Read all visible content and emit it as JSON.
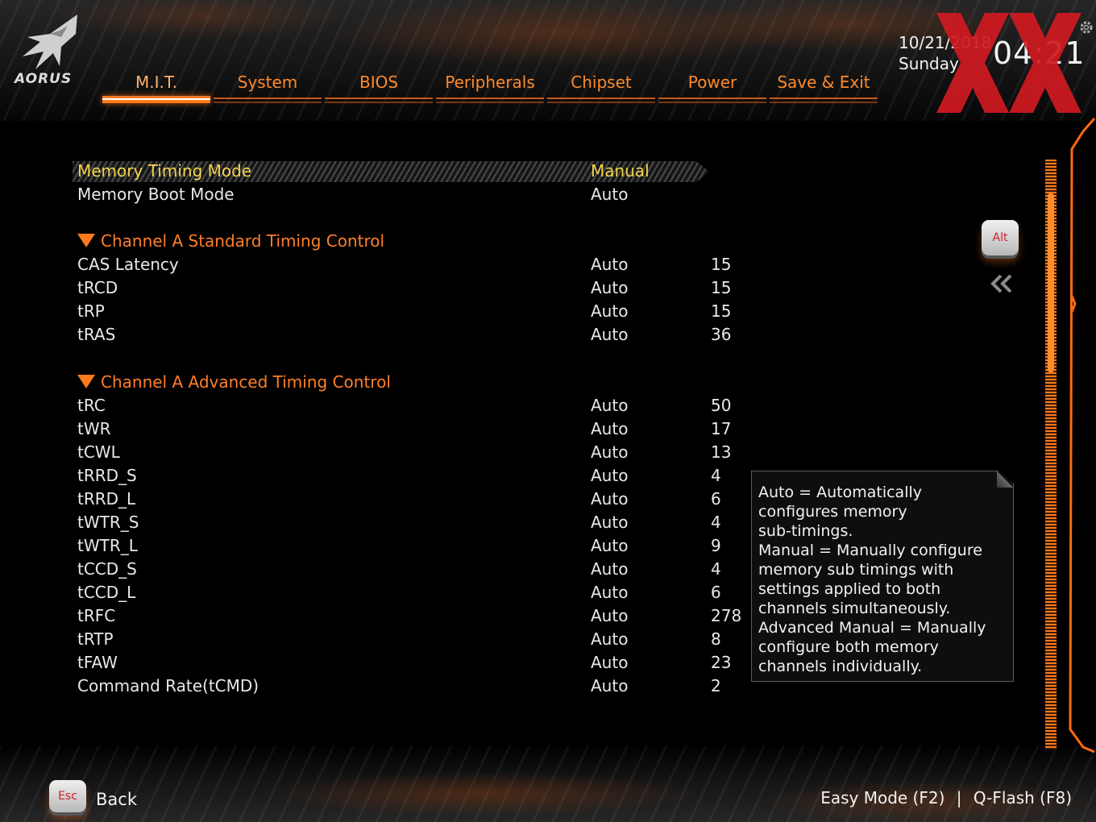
{
  "brand": {
    "logo_text": "AORUS"
  },
  "nav": {
    "tabs": [
      {
        "label": "M.I.T.",
        "active": true
      },
      {
        "label": "System",
        "active": false
      },
      {
        "label": "BIOS",
        "active": false
      },
      {
        "label": "Peripherals",
        "active": false
      },
      {
        "label": "Chipset",
        "active": false
      },
      {
        "label": "Power",
        "active": false
      },
      {
        "label": "Save & Exit",
        "active": false
      }
    ]
  },
  "datetime": {
    "date": "10/21/2018",
    "day": "Sunday",
    "time": "04:21"
  },
  "top_rows": [
    {
      "label": "Memory Timing Mode",
      "mode": "Manual",
      "value": ""
    },
    {
      "label": "Memory Boot Mode",
      "mode": "Auto",
      "value": ""
    }
  ],
  "sections": {
    "standard": {
      "title": "Channel A Standard Timing Control",
      "rows": [
        {
          "label": "CAS Latency",
          "mode": "Auto",
          "value": "15"
        },
        {
          "label": "tRCD",
          "mode": "Auto",
          "value": "15"
        },
        {
          "label": "tRP",
          "mode": "Auto",
          "value": "15"
        },
        {
          "label": "tRAS",
          "mode": "Auto",
          "value": "36"
        }
      ]
    },
    "advanced": {
      "title": "Channel A Advanced Timing Control",
      "rows": [
        {
          "label": "tRC",
          "mode": "Auto",
          "value": "50"
        },
        {
          "label": "tWR",
          "mode": "Auto",
          "value": "17"
        },
        {
          "label": "tCWL",
          "mode": "Auto",
          "value": "13"
        },
        {
          "label": "tRRD_S",
          "mode": "Auto",
          "value": "4"
        },
        {
          "label": "tRRD_L",
          "mode": "Auto",
          "value": "6"
        },
        {
          "label": "tWTR_S",
          "mode": "Auto",
          "value": "4"
        },
        {
          "label": "tWTR_L",
          "mode": "Auto",
          "value": "9"
        },
        {
          "label": "tCCD_S",
          "mode": "Auto",
          "value": "4"
        },
        {
          "label": "tCCD_L",
          "mode": "Auto",
          "value": "6"
        },
        {
          "label": "tRFC",
          "mode": "Auto",
          "value": "278"
        },
        {
          "label": "tRTP",
          "mode": "Auto",
          "value": "8"
        },
        {
          "label": "tFAW",
          "mode": "Auto",
          "value": "23"
        },
        {
          "label": "Command Rate(tCMD)",
          "mode": "Auto",
          "value": "2"
        }
      ]
    }
  },
  "help": {
    "lines": [
      "Auto = Automatically",
      "configures memory",
      "sub-timings.",
      "Manual = Manually configure",
      "memory sub timings with",
      "settings applied to both",
      "channels simultaneously.",
      "Advanced Manual = Manually",
      "configure both memory",
      "channels individually."
    ]
  },
  "side": {
    "alt_key": "Alt"
  },
  "footer": {
    "esc_key": "Esc",
    "back": "Back",
    "easy_mode": "Easy Mode (F2)",
    "separator": "|",
    "qflash": "Q-Flash (F8)"
  },
  "colors": {
    "accent": "#ff7a1a",
    "selected_text": "#f3d34a",
    "text": "#e8e8e8",
    "watermark": "#d11a22"
  }
}
